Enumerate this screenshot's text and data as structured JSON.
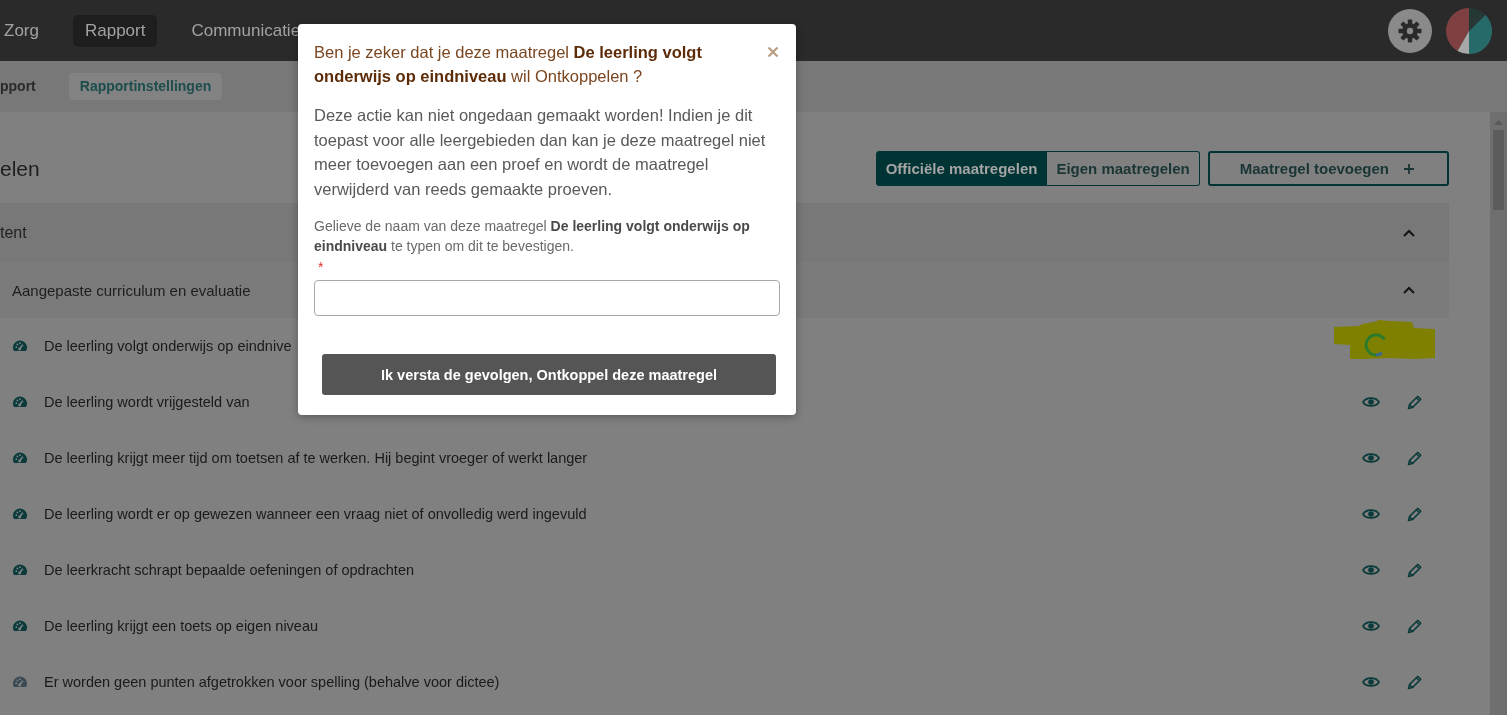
{
  "top_nav": {
    "items": [
      {
        "label": "Zorg",
        "selected": false
      },
      {
        "label": "Rapport",
        "selected": true
      },
      {
        "label": "Communicatie",
        "selected": false
      }
    ]
  },
  "sub_nav": {
    "items": [
      {
        "label": "pport",
        "selected": false
      },
      {
        "label": "Rapportinstellingen",
        "selected": true
      }
    ]
  },
  "page": {
    "title": "elen",
    "view_toggle": [
      {
        "label": "Officiële maatregelen",
        "selected": true
      },
      {
        "label": "Eigen maatregelen",
        "selected": false
      }
    ],
    "add_button": {
      "label": "Maatregel toevoegen"
    }
  },
  "section": {
    "title": "tent",
    "expanded": true,
    "subsection": {
      "title": "Aangepaste curriculum en evaluatie",
      "expanded": true,
      "rows": [
        {
          "text": "De leerling volgt onderwijs op eindnive",
          "dimmed": false,
          "loading": true,
          "highlighted": true
        },
        {
          "text": "De leerling wordt vrijgesteld van",
          "dimmed": false,
          "loading": false,
          "highlighted": false
        },
        {
          "text": "De leerling krijgt meer tijd om toetsen af te werken. Hij begint vroeger of werkt langer",
          "dimmed": false,
          "loading": false,
          "highlighted": false
        },
        {
          "text": "De leerling wordt er op gewezen wanneer een vraag niet of onvolledig werd ingevuld",
          "dimmed": false,
          "loading": false,
          "highlighted": false
        },
        {
          "text": "De leerkracht schrapt bepaalde oefeningen of opdrachten",
          "dimmed": false,
          "loading": false,
          "highlighted": false
        },
        {
          "text": "De leerling krijgt een toets op eigen niveau",
          "dimmed": false,
          "loading": false,
          "highlighted": false
        },
        {
          "text": "Er worden geen punten afgetrokken voor spelling (behalve voor dictee)",
          "dimmed": true,
          "loading": false,
          "highlighted": false
        }
      ]
    }
  },
  "modal": {
    "title": "Ben je zeker dat je deze maatregel **De leerling volgt onderwijs op eindniveau** wil Ontkoppelen ?",
    "message": "Deze actie kan niet ongedaan gemaakt worden! Indien je dit toepast voor alle leergebieden dan kan je deze maatregel niet meer toevoegen aan een proef en wordt de maatregel verwijderd van reeds gemaakte proeven.",
    "instruction": "Gelieve de naam van deze maatregel **De leerling volgt onderwijs op eindniveau** te typen om dit te bevestigen.",
    "required_mark": "*",
    "confirm_button": "Ik versta de gevolgen, Ontkoppel deze maatregel"
  }
}
